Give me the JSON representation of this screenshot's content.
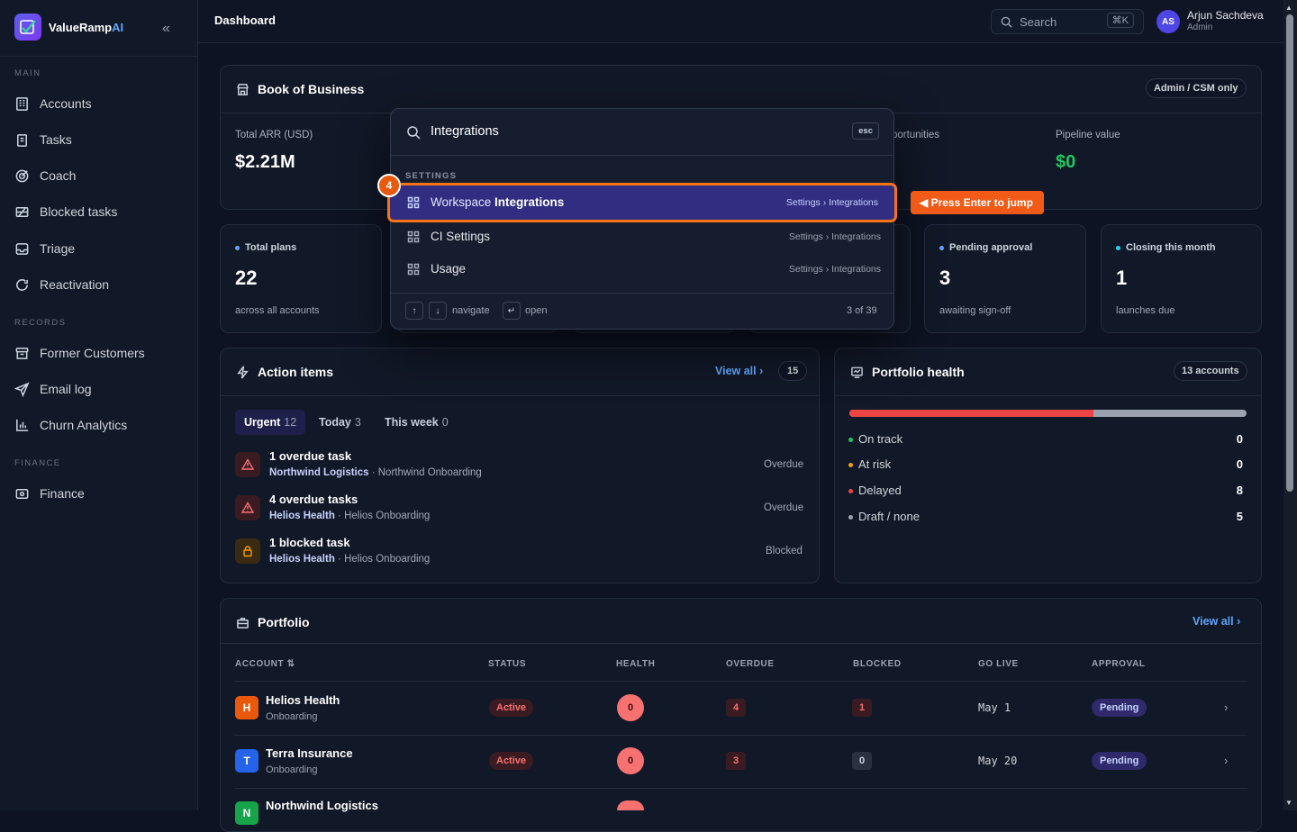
{
  "brand": {
    "name_main": "ValueRamp",
    "name_accent": "AI"
  },
  "sidebar": {
    "sections": [
      "MAIN",
      "RECORDS",
      "FINANCE"
    ],
    "items": [
      {
        "label": "Accounts",
        "icon": "building-icon"
      },
      {
        "label": "Tasks",
        "icon": "clipboard-icon"
      },
      {
        "label": "Coach",
        "icon": "target-icon"
      },
      {
        "label": "Blocked tasks",
        "icon": "blocked-icon"
      },
      {
        "label": "Triage",
        "icon": "inbox-icon"
      },
      {
        "label": "Reactivation",
        "icon": "refresh-icon"
      },
      {
        "label": "Former Customers",
        "icon": "archive-icon"
      },
      {
        "label": "Email log",
        "icon": "send-icon"
      },
      {
        "label": "Churn Analytics",
        "icon": "chart-icon"
      },
      {
        "label": "Finance",
        "icon": "wallet-icon"
      }
    ]
  },
  "topbar": {
    "title": "Dashboard",
    "search_label": "Search",
    "shortcut": "⌘K",
    "user_initials": "AS",
    "user_name": "Arjun Sachdeva",
    "user_role": "Admin"
  },
  "book": {
    "title": "Book of Business",
    "badge": "Admin / CSM only",
    "stats": [
      {
        "label": "Total ARR (USD)",
        "value": "$2.21M"
      },
      {
        "label": "portunities",
        "value": ""
      },
      {
        "label": "Pipeline value",
        "value": "$0"
      }
    ]
  },
  "mini_stats": [
    {
      "label": "Total plans",
      "value": "22",
      "sub": "across all accounts",
      "dot": "#60a5fa"
    },
    {
      "label": "Pending approval",
      "value": "3",
      "sub": "awaiting sign-off",
      "dot": "#60a5fa"
    },
    {
      "label": "Closing this month",
      "value": "1",
      "sub": "launches due",
      "dot": "#22d3ee"
    }
  ],
  "action_items": {
    "title": "Action items",
    "view_all": "View all",
    "count": "15",
    "tabs": [
      {
        "label": "Urgent",
        "count": "12"
      },
      {
        "label": "Today",
        "count": "3"
      },
      {
        "label": "This week",
        "count": "0"
      }
    ],
    "items": [
      {
        "title": "1 overdue task",
        "account": "Northwind Logistics",
        "plan": " · Northwind Onboarding",
        "status": "Overdue"
      },
      {
        "title": "4 overdue tasks",
        "account": "Helios Health",
        "plan": " · Helios Onboarding",
        "status": "Overdue"
      },
      {
        "title": "1 blocked task",
        "account": "Helios Health",
        "plan": " · Helios Onboarding",
        "status": "Blocked"
      }
    ]
  },
  "health": {
    "title": "Portfolio health",
    "badge": "13 accounts",
    "bar": {
      "delayed_fraction": 0.615
    },
    "legend": [
      {
        "label": "On track",
        "value": "0",
        "color": "#22c55e"
      },
      {
        "label": "At risk",
        "value": "0",
        "color": "#f59e0b"
      },
      {
        "label": "Delayed",
        "value": "8",
        "color": "#ef4444"
      },
      {
        "label": "Draft / none",
        "value": "5",
        "color": "#9ca3af"
      }
    ]
  },
  "portfolio": {
    "title": "Portfolio",
    "view_all": "View all",
    "columns": [
      "ACCOUNT",
      "STATUS",
      "HEALTH",
      "OVERDUE",
      "BLOCKED",
      "GO LIVE",
      "APPROVAL"
    ],
    "rows": [
      {
        "initial": "H",
        "name": "Helios Health",
        "stage": "Onboarding",
        "status": "Active",
        "health": "0",
        "overdue": "4",
        "blocked": "1",
        "go_live": "May 1",
        "approval": "Pending",
        "color": "#ea580c"
      },
      {
        "initial": "T",
        "name": "Terra Insurance",
        "stage": "Onboarding",
        "status": "Active",
        "health": "0",
        "overdue": "3",
        "blocked": "0",
        "go_live": "May 20",
        "approval": "Pending",
        "color": "#2563eb"
      },
      {
        "initial": "N",
        "name": "Northwind Logistics",
        "stage": "",
        "status": "",
        "health": "",
        "overdue": "",
        "blocked": "",
        "go_live": "",
        "approval": "",
        "color": "#16a34a"
      }
    ]
  },
  "palette": {
    "query": "Integrations",
    "esc": "esc",
    "section": "SETTINGS",
    "step": "4",
    "jump_hint": "Press Enter to jump",
    "items": [
      {
        "prefix": "Workspace ",
        "match": "Integrations",
        "path": "Settings › Integrations"
      },
      {
        "label": "CI Settings",
        "path": "Settings › Integrations"
      },
      {
        "label": "Usage",
        "path": "Settings › Integrations"
      }
    ],
    "footer": {
      "navigate": "navigate",
      "open": "open",
      "count": "3 of 39"
    }
  }
}
